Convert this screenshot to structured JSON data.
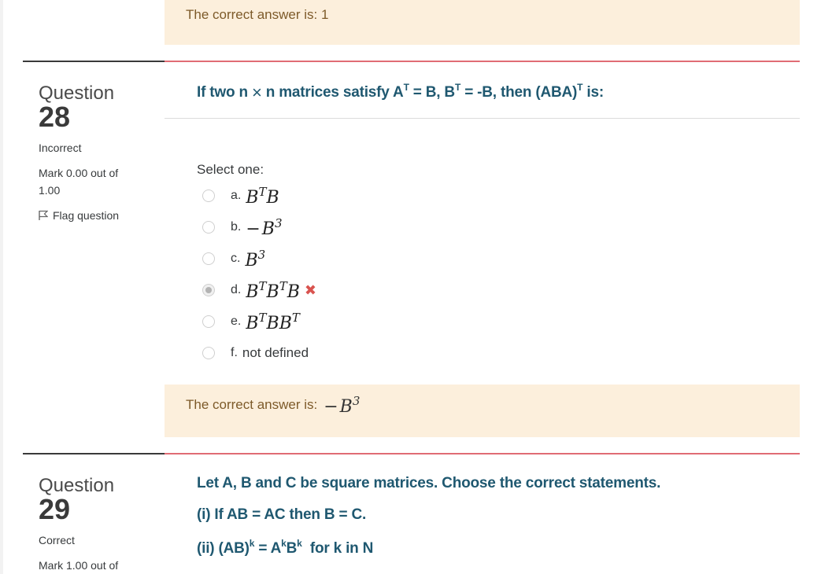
{
  "top_feedback": "The correct answer is: 1",
  "q28": {
    "label": "Question",
    "number": "28",
    "state": "Incorrect",
    "grade": "Mark 0.00 out of 1.00",
    "flag": "Flag question",
    "text_a": "If two n",
    "times": "×",
    "text_b": "n matrices satisfy A",
    "sup_t": "T",
    "text_c": " = B, B",
    "text_d": " = -B, then (ABA)",
    "text_e": " is:",
    "prompt": "Select one:",
    "answers": [
      {
        "letter": "a.",
        "math": "BᵀB",
        "base1": "B",
        "sup1": "T",
        "base2": "B"
      },
      {
        "letter": "b.",
        "neg": "−",
        "base1": "B",
        "sup1": "3"
      },
      {
        "letter": "c.",
        "base1": "B",
        "sup1": "3"
      },
      {
        "letter": "d.",
        "base1": "B",
        "sup1": "T",
        "base2": "B",
        "sup2": "T",
        "base3": "B",
        "selected": true,
        "mark": "✖"
      },
      {
        "letter": "e.",
        "base1": "B",
        "sup1": "T",
        "base2": "B",
        "base3": "B",
        "sup3": "T"
      },
      {
        "letter": "f.",
        "text": "not defined"
      }
    ],
    "feedback": "The correct answer is:",
    "feedback_neg": "−",
    "feedback_base": "B",
    "feedback_sup": "3"
  },
  "q29": {
    "label": "Question",
    "number": "29",
    "state": "Correct",
    "grade": "Mark 1.00 out of",
    "line1": "Let A, B and C be square matrices. Choose the correct statements.",
    "line2": "(i) If AB = AC then B = C.",
    "line3_a": "(ii) (AB)",
    "line3_sup": "k",
    "line3_b": " = A",
    "line3_c": "B",
    "line3_d": "  for k in N"
  },
  "colors": {
    "feedback_bg": "#fcefdc",
    "feedback_text": "#7d5a29",
    "question_text": "#1f5870",
    "divider_accent": "#e06c74",
    "incorrect_mark": "#d9534f"
  }
}
